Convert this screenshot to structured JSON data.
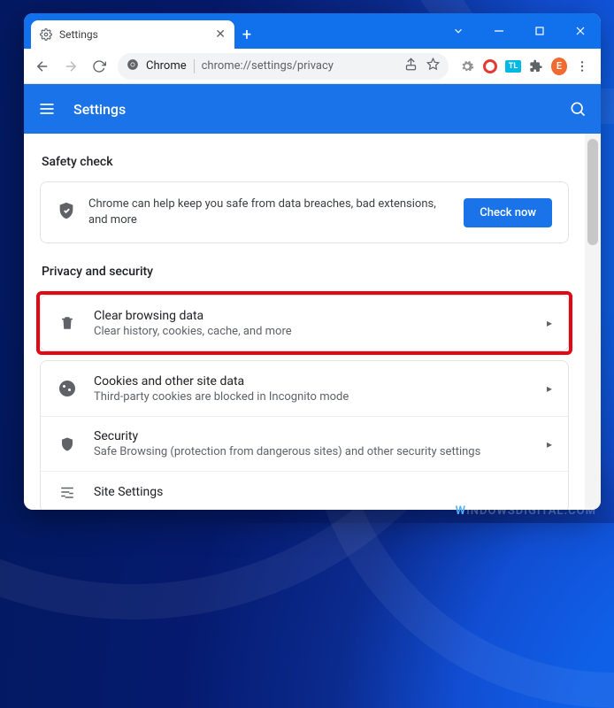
{
  "window": {
    "tab_title": "Settings",
    "chevron": "⌄"
  },
  "omnibox": {
    "origin": "Chrome",
    "url": "chrome://settings/privacy"
  },
  "extensions": {
    "tl_label": "TL",
    "avatar_letter": "E"
  },
  "appheader": {
    "title": "Settings"
  },
  "safety": {
    "section_title": "Safety check",
    "description": "Chrome can help keep you safe from data breaches, bad extensions, and more",
    "button": "Check now"
  },
  "privacy": {
    "section_title": "Privacy and security",
    "rows": [
      {
        "title": "Clear browsing data",
        "sub": "Clear history, cookies, cache, and more"
      },
      {
        "title": "Cookies and other site data",
        "sub": "Third-party cookies are blocked in Incognito mode"
      },
      {
        "title": "Security",
        "sub": "Safe Browsing (protection from dangerous sites) and other security settings"
      },
      {
        "title": "Site Settings",
        "sub": ""
      }
    ]
  },
  "watermark": {
    "w": "W",
    "rest": "INDOWSDIGITAL.COM"
  }
}
